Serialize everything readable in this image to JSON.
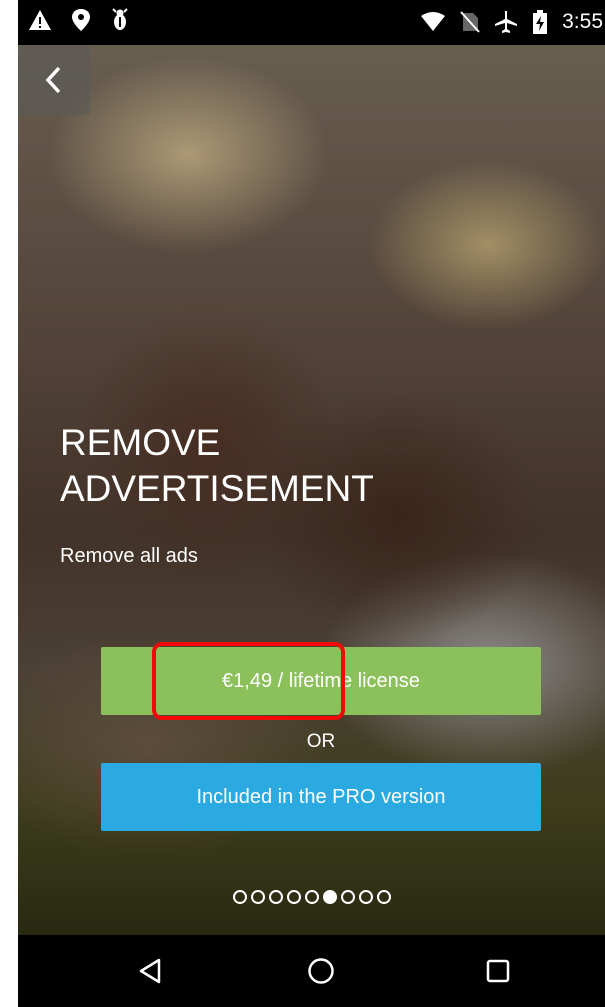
{
  "status_bar": {
    "time": "3:55",
    "left_icons": [
      "warning-icon",
      "location-icon",
      "debug-icon"
    ],
    "right_icons": [
      "wifi-icon",
      "no-sim-icon",
      "airplane-icon",
      "battery-charging-icon"
    ]
  },
  "screen": {
    "title": "REMOVE ADVERTISEMENT",
    "subtitle": "Remove all ads",
    "buy_label": "€1,49 / lifetime license",
    "or_label": "OR",
    "pro_label": "Included in the PRO version"
  },
  "pager": {
    "total": 9,
    "active_index": 5
  },
  "colors": {
    "buy_button": "#8bc05a",
    "pro_button": "#2ba9e1",
    "highlight": "#f00a0a"
  },
  "nav_bar": {
    "icons": [
      "back-triangle-icon",
      "home-circle-icon",
      "recents-square-icon"
    ]
  }
}
